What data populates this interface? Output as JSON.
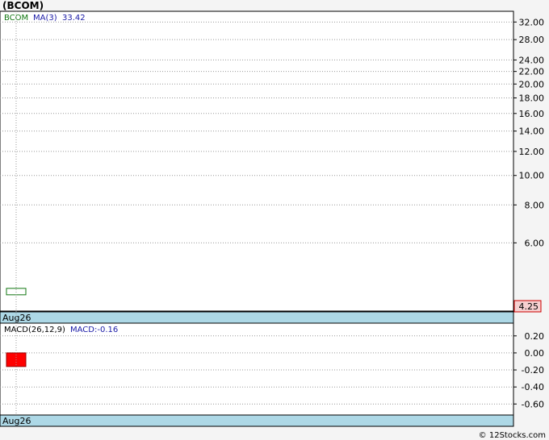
{
  "header": {
    "title": "(BCOM)"
  },
  "footer": {
    "credit": "© 12Stocks.com"
  },
  "colors": {
    "candle_up": "#117711",
    "macd_negative": "#ff0000",
    "ma_text": "#1a1aa6",
    "price_badge_bg": "#f6d0d0",
    "price_badge_text": "#cc0000",
    "date_strip": "#add8e6"
  },
  "chart_data": [
    {
      "type": "candlestick",
      "panel": "price",
      "legend": {
        "symbol": "BCOM",
        "ma_label": "MA(3)",
        "ma_value": "33.42"
      },
      "scale": "log",
      "ylim": [
        3.6,
        34.5
      ],
      "yticks": [
        {
          "v": 32,
          "label": "32.00"
        },
        {
          "v": 28,
          "label": "28.00"
        },
        {
          "v": 24,
          "label": "24.00"
        },
        {
          "v": 22,
          "label": "22.00"
        },
        {
          "v": 20,
          "label": "20.00"
        },
        {
          "v": 18,
          "label": "18.00"
        },
        {
          "v": 16,
          "label": "16.00"
        },
        {
          "v": 14,
          "label": "14.00"
        },
        {
          "v": 12,
          "label": "12.00"
        },
        {
          "v": 10,
          "label": "10.00"
        },
        {
          "v": 8,
          "label": "8.00"
        },
        {
          "v": 6,
          "label": "6.00"
        }
      ],
      "candles": [
        {
          "date": "Aug26",
          "open": 4.05,
          "close": 4.25,
          "high": 4.25,
          "low": 4.05
        }
      ],
      "last_price": "4.25",
      "x_label": "Aug26",
      "grid": true
    },
    {
      "type": "bar",
      "panel": "macd",
      "legend": {
        "label": "MACD(26,12,9)",
        "value_label": "MACD:-0.16"
      },
      "ylim": [
        -0.72,
        0.34
      ],
      "yticks": [
        {
          "v": 0.2,
          "label": "0.20"
        },
        {
          "v": 0.0,
          "label": "0.00"
        },
        {
          "v": -0.2,
          "label": "-0.20"
        },
        {
          "v": -0.4,
          "label": "-0.40"
        },
        {
          "v": -0.6,
          "label": "-0.60"
        }
      ],
      "bars": [
        {
          "date": "Aug26",
          "value": -0.16
        }
      ],
      "x_label": "Aug26",
      "grid": true
    }
  ]
}
